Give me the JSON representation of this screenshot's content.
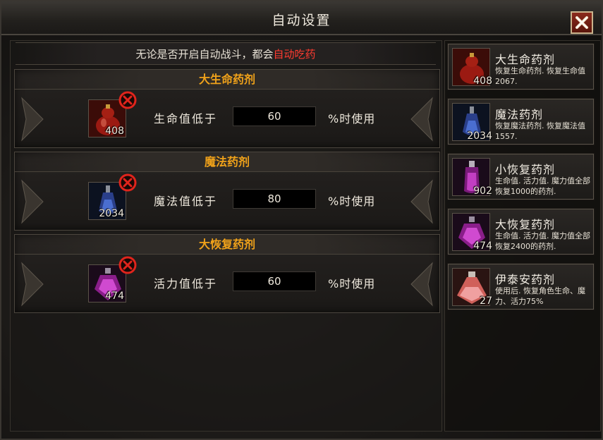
{
  "window": {
    "title": "自动设置"
  },
  "notice": {
    "prefix": "无论是否开启自动战斗，都会",
    "highlight": "自动吃药"
  },
  "colors": {
    "section_title": "#f0a21a",
    "highlight": "#ff3b30",
    "remove": "#e0241c"
  },
  "settings": [
    {
      "title": "大生命药剂",
      "icon": "red-health-potion-icon",
      "count": "408",
      "label": "生命值低于",
      "value": "60",
      "unit": "%时使用"
    },
    {
      "title": "魔法药剂",
      "icon": "blue-mana-potion-icon",
      "count": "2034",
      "label": "魔法值低于",
      "value": "80",
      "unit": "%时使用"
    },
    {
      "title": "大恢复药剂",
      "icon": "purple-restore-potion-icon",
      "count": "474",
      "label": "活力值低于",
      "value": "60",
      "unit": "%时使用"
    }
  ],
  "potions": [
    {
      "name": "大生命药剂",
      "count": "408",
      "icon": "red-health-potion-icon",
      "desc": "恢复生命药剂. 恢复生命值2067."
    },
    {
      "name": "魔法药剂",
      "count": "2034",
      "icon": "blue-mana-potion-icon",
      "desc": "恢复魔法药剂. 恢复魔法值1557."
    },
    {
      "name": "小恢复药剂",
      "count": "902",
      "icon": "small-restore-potion-icon",
      "desc": "生命值. 活力值. 魔力值全部恢复1000的药剂."
    },
    {
      "name": "大恢复药剂",
      "count": "474",
      "icon": "purple-restore-potion-icon",
      "desc": "生命值. 活力值. 魔力值全部恢复2400的药剂."
    },
    {
      "name": "伊泰安药剂",
      "count": "27",
      "icon": "pink-flask-potion-icon",
      "desc": "使用后. 恢复角色生命、魔力、活力75%"
    }
  ]
}
